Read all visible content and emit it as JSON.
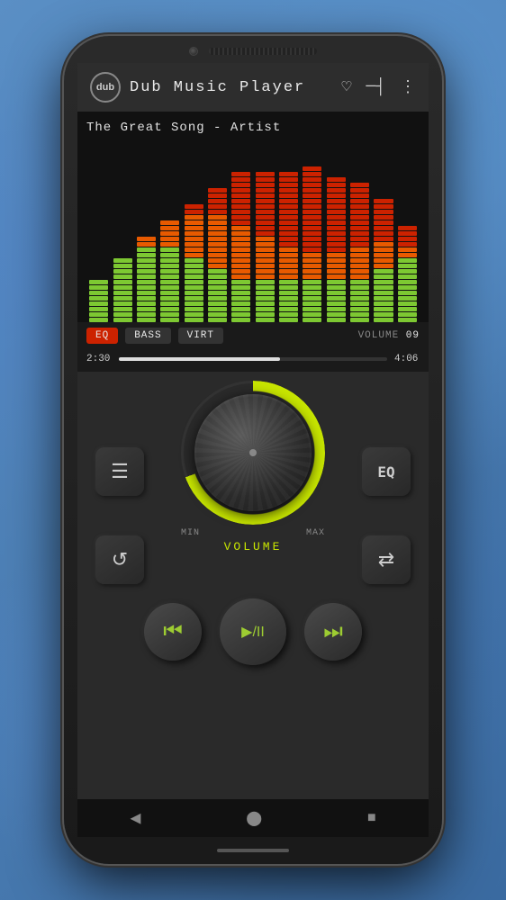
{
  "app": {
    "logo_text": "dub",
    "title": "Dub  Music  Player",
    "header_icons": {
      "heart": "♡",
      "equalizer": "─┤",
      "menu": "⋮"
    }
  },
  "player": {
    "song_title": "The Great Song - Artist",
    "eq_button": "EQ",
    "bass_button": "BASS",
    "virt_button": "VIRT",
    "volume_label": "VOLUME",
    "volume_value": "09",
    "time_current": "2:30",
    "time_total": "4:06",
    "progress_percent": 60,
    "min_label": "MIN",
    "max_label": "MAX",
    "volume_knob_label": "VOLUME"
  },
  "controls": {
    "playlist_icon": "☰",
    "eq_icon": "EQ",
    "repeat_icon": "↺",
    "shuffle_icon": "⇄",
    "prev_icon": "⏮",
    "play_pause_icon": "▶/II",
    "next_icon": "⏭"
  },
  "nav": {
    "back": "◀",
    "home": "⬤",
    "recent": "■"
  },
  "eq_bars": [
    {
      "green": 8,
      "orange": 0,
      "red": 0
    },
    {
      "green": 12,
      "orange": 0,
      "red": 0
    },
    {
      "green": 14,
      "orange": 2,
      "red": 0
    },
    {
      "green": 14,
      "orange": 5,
      "red": 0
    },
    {
      "green": 12,
      "orange": 8,
      "red": 2
    },
    {
      "green": 10,
      "orange": 10,
      "red": 5
    },
    {
      "green": 8,
      "orange": 10,
      "red": 10
    },
    {
      "green": 8,
      "orange": 8,
      "red": 12
    },
    {
      "green": 8,
      "orange": 6,
      "red": 14
    },
    {
      "green": 8,
      "orange": 5,
      "red": 16
    },
    {
      "green": 8,
      "orange": 5,
      "red": 14
    },
    {
      "green": 8,
      "orange": 6,
      "red": 12
    },
    {
      "green": 10,
      "orange": 5,
      "red": 8
    },
    {
      "green": 12,
      "orange": 2,
      "red": 4
    }
  ]
}
